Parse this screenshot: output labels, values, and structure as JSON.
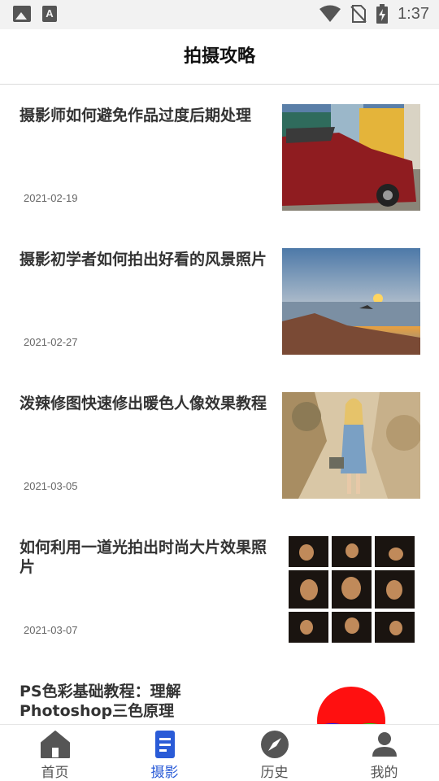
{
  "status_bar": {
    "time": "1:37"
  },
  "header": {
    "title": "拍摄攻略"
  },
  "articles": [
    {
      "title": "摄影师如何避免作品过度后期处理",
      "date": "2021-02-19",
      "thumb": "red-classic-car-street-photo"
    },
    {
      "title": "摄影初学者如何拍出好看的风景照片",
      "date": "2021-02-27",
      "thumb": "sunset-rocky-coast-photo"
    },
    {
      "title": "泼辣修图快速修出暖色人像效果教程",
      "date": "2021-03-05",
      "thumb": "woman-portrait-plants-photo"
    },
    {
      "title": "如何利用一道光拍出时尚大片效果照片",
      "date": "2021-03-07",
      "thumb": "portrait-grid-photos"
    },
    {
      "title": "PS色彩基础教程：理解Photoshop三色原理",
      "date": "",
      "thumb": "rgb-color-circles"
    }
  ],
  "nav": {
    "items": [
      {
        "label": "首页",
        "icon": "home-icon"
      },
      {
        "label": "摄影",
        "icon": "document-icon"
      },
      {
        "label": "历史",
        "icon": "compass-icon"
      },
      {
        "label": "我的",
        "icon": "person-icon"
      }
    ],
    "active_index": 1,
    "active_color": "#2a5bd7",
    "inactive_color": "#555555"
  }
}
